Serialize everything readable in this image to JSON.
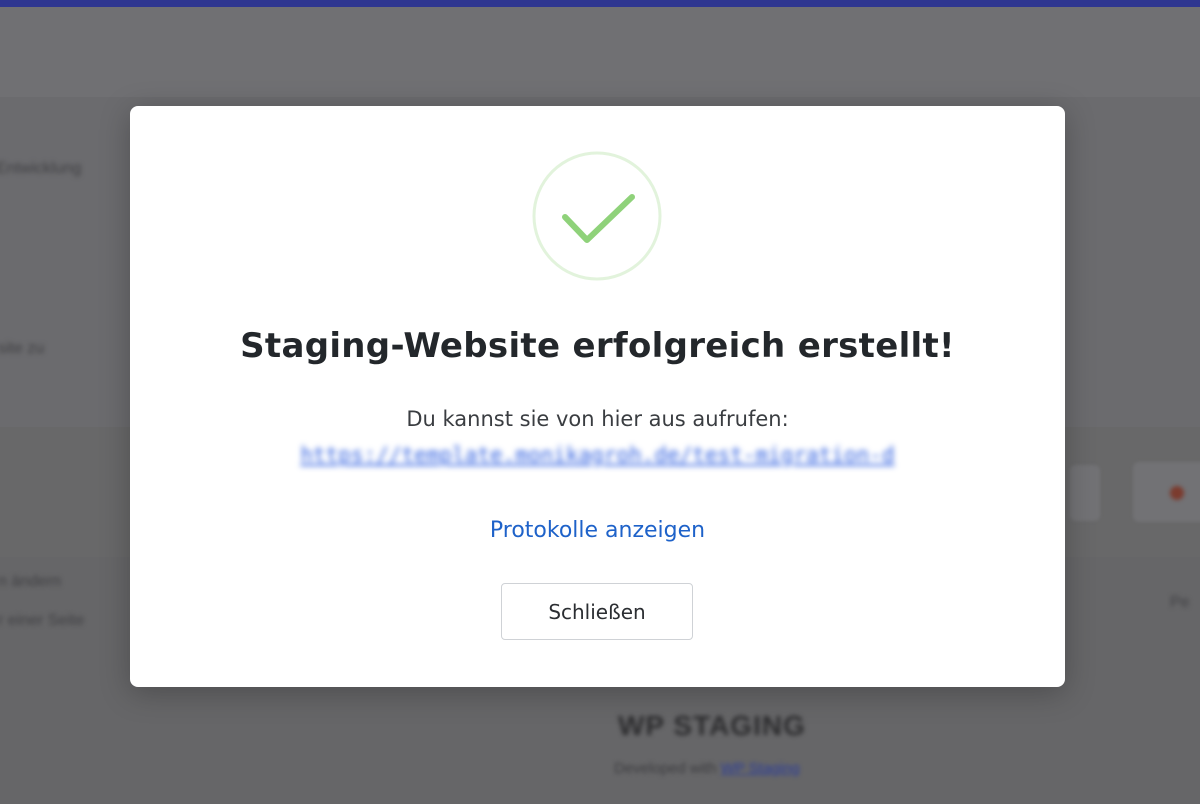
{
  "dialog": {
    "title": "Staging-Website erfolgreich erstellt!",
    "subtitle": "Du kannst sie von hier aus aufrufen:",
    "staging_url": "https://template.monikagroh.de/test-migration-d",
    "logs_link": "Protokolle anzeigen",
    "close_label": "Schließen",
    "icon": "checkmark-circle-icon",
    "accent_color": "#8fd27a"
  },
  "background": {
    "fragment_1": "Entwicklung",
    "fragment_2": "site zu",
    "fragment_3": "n ändern",
    "fragment_4": "r einer Seite",
    "fragment_5": "Pe",
    "footer_logo": "WP STAGING",
    "footer_credit_prefix": "Developed with",
    "footer_credit_link": "WP Staging"
  }
}
